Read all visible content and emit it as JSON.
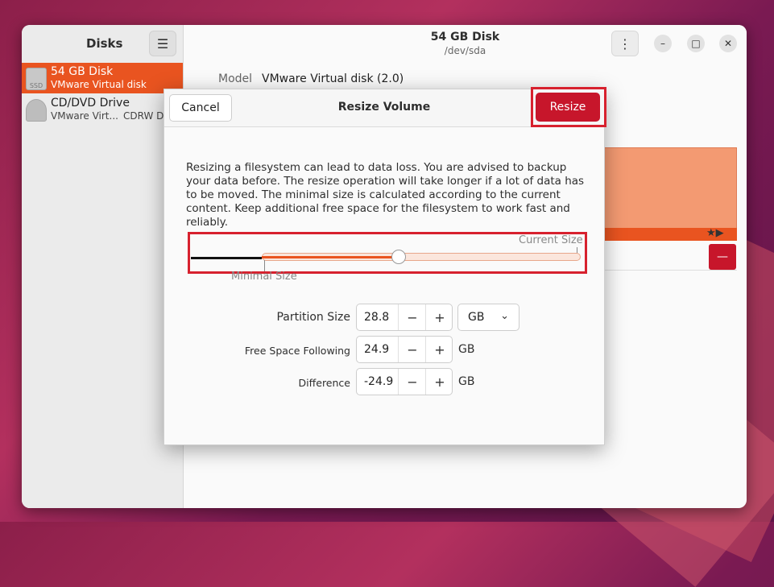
{
  "sidebar": {
    "title": "Disks",
    "items": [
      {
        "name": "54 GB Disk",
        "sub": "VMware Virtual disk",
        "icon_label": "SSD"
      },
      {
        "name": "CD/DVD Drive",
        "sub": "VMware Virt...",
        "sub2": "CDRW D"
      }
    ]
  },
  "main": {
    "title": "54 GB Disk",
    "subtitle": "/dev/sda",
    "model_label": "Model",
    "model_value": "VMware Virtual disk (2.0)"
  },
  "dialog": {
    "title": "Resize Volume",
    "cancel_label": "Cancel",
    "resize_label": "Resize",
    "warning": "Resizing a filesystem can lead to data loss. You are advised to backup your data before. The resize operation will take longer if a lot of data has to be moved. The minimal size is calculated according to the current content. Keep additional free space for the filesystem to work fast and reliably.",
    "slider": {
      "current_size_label": "Current Size",
      "minimal_size_label": "Minimal Size",
      "value_fraction": 0.43
    },
    "fields": {
      "partition_size": {
        "label": "Partition Size",
        "value": "28.8",
        "unit": "GB"
      },
      "free_space": {
        "label": "Free Space Following",
        "value": "24.9",
        "unit": "GB"
      },
      "difference": {
        "label": "Difference",
        "value": "-24.9",
        "unit": "GB"
      }
    },
    "spin_minus": "−",
    "spin_plus": "+"
  },
  "icons": {
    "menu": "hamburger-icon",
    "kebab": "kebab-menu-icon",
    "minimize": "minimize-icon",
    "maximize": "maximize-icon",
    "close": "close-icon",
    "chevron": "chevron-down-icon"
  },
  "colors": {
    "accent": "#e95420",
    "destructive": "#c7162b",
    "highlight": "#d7212e"
  }
}
